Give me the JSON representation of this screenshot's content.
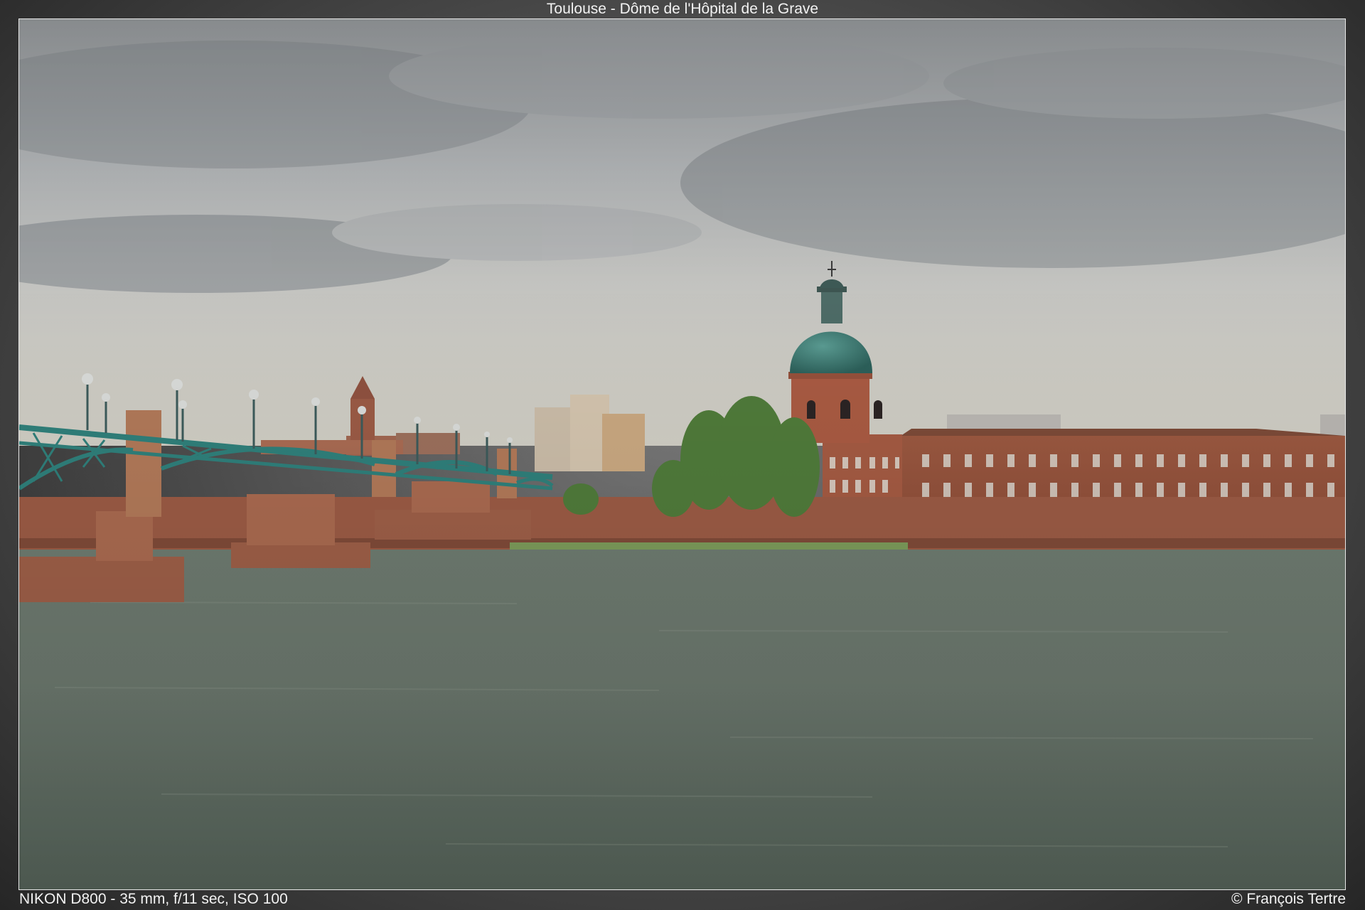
{
  "photo": {
    "title": "Toulouse - Dôme de l'Hôpital de la Grave",
    "camera_info": "NIKON D800 - 35 mm, f/11 sec, ISO 100",
    "credit": "© François Tertre"
  },
  "colors": {
    "sky": "#b9bcbe",
    "dome": "#3f7f78",
    "brick": "#a4563f",
    "river": "#5f6f63",
    "bridge": "#2f7f7a"
  }
}
